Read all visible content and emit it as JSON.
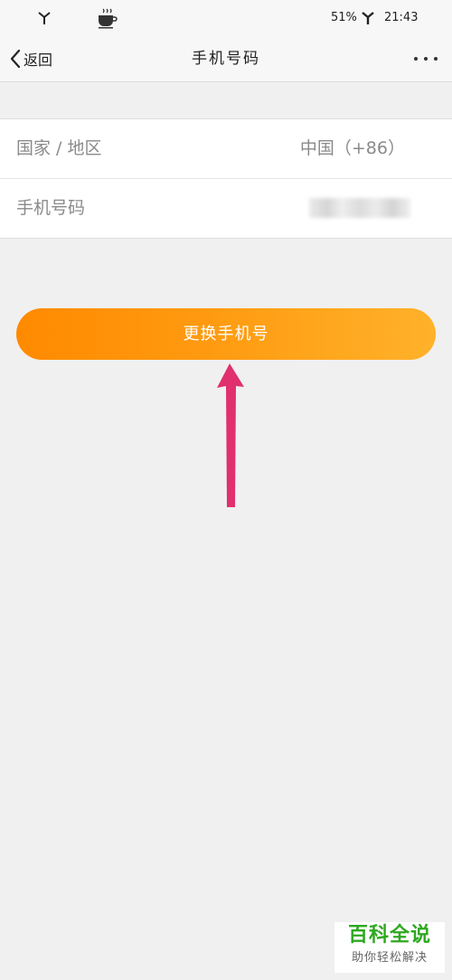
{
  "status_bar": {
    "battery": "51%",
    "time": "21:43"
  },
  "nav": {
    "back_label": "返回",
    "title": "手机号码",
    "more_icon": "more-horizontal-icon"
  },
  "form": {
    "rows": [
      {
        "label": "国家 / 地区",
        "value": "中国（+86）"
      },
      {
        "label": "手机号码",
        "value": ""
      }
    ]
  },
  "button": {
    "label": "更换手机号"
  },
  "watermark": {
    "title": "百科全说",
    "subtitle": "助你轻松解决"
  },
  "colors": {
    "button_start": "#ff8a00",
    "button_end": "#ffb22a",
    "arrow": "#e0306e",
    "watermark_green": "#2ea820"
  }
}
